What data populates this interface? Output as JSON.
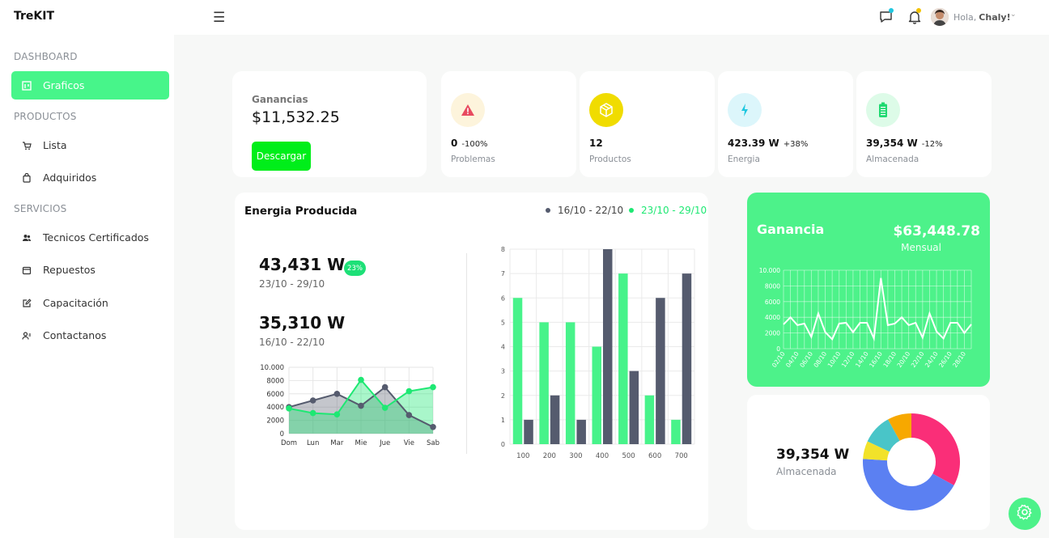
{
  "app": {
    "brand": "TreKIT"
  },
  "sidebar": {
    "sections": [
      {
        "title": "DASHBOARD",
        "items": [
          {
            "label": "Graficos",
            "icon": "chart-icon",
            "active": true
          }
        ]
      },
      {
        "title": "PRODUCTOS",
        "items": [
          {
            "label": "Lista",
            "icon": "cart-icon"
          },
          {
            "label": "Adquiridos",
            "icon": "bag-icon"
          }
        ]
      },
      {
        "title": "SERVICIOS",
        "items": [
          {
            "label": "Tecnicos Certificados",
            "icon": "users-icon"
          },
          {
            "label": "Repuestos",
            "icon": "box-icon"
          },
          {
            "label": "Capacitación",
            "icon": "edit-icon"
          },
          {
            "label": "Contactanos",
            "icon": "user-contact-icon"
          }
        ]
      }
    ]
  },
  "topbar": {
    "greeting": "Hola,",
    "username": "Chaly!"
  },
  "ganancias": {
    "title": "Ganancias",
    "value": "$11,532.25",
    "button": "Descargar"
  },
  "stats": [
    {
      "value": "0",
      "change": "-100%",
      "label": "Problemas",
      "icon": "warning-icon",
      "color": "#fdf4dc",
      "icon_color": "#e84a5f"
    },
    {
      "value": "12",
      "change": "",
      "label": "Productos",
      "icon": "package-icon",
      "color": "#f0dc00",
      "icon_color": "#ffffff"
    },
    {
      "value": "423.39 W",
      "change": "+38%",
      "label": "Energia",
      "icon": "bolt-icon",
      "color": "#dcf6fb",
      "icon_color": "#1fc7e0"
    },
    {
      "value": "39,354 W",
      "change": "-12%",
      "label": "Almacenada",
      "icon": "battery-icon",
      "color": "#ddfbe8",
      "icon_color": "#1ed970"
    }
  ],
  "energia": {
    "title": "Energia Producida",
    "legend": [
      {
        "label": "16/10 - 22/10",
        "color": "#555b6e"
      },
      {
        "label": "23/10 - 29/10",
        "color": "#1ee873"
      }
    ],
    "current": {
      "value": "43,431 W",
      "range": "23/10 - 29/10",
      "badge": "23%"
    },
    "previous": {
      "value": "35,310 W",
      "range": "16/10 - 22/10"
    }
  },
  "ganancia_card": {
    "title": "Ganancia",
    "value": "$63,448.78",
    "sub": "Mensual"
  },
  "almacenada": {
    "value": "39,354 W",
    "label": "Almacenada"
  },
  "chart_data": [
    {
      "type": "area",
      "categories": [
        "Dom",
        "Lun",
        "Mar",
        "Mie",
        "Jue",
        "Vie",
        "Sab"
      ],
      "ylim": [
        0,
        10000
      ],
      "yticks": [
        "10.000",
        "8000",
        "6000",
        "4000",
        "2000",
        "0"
      ],
      "series": [
        {
          "name": "16/10 - 22/10",
          "values": [
            4000,
            5000,
            6000,
            4200,
            7000,
            2800,
            1000
          ],
          "color": "#555b6e"
        },
        {
          "name": "23/10 - 29/10",
          "values": [
            3800,
            3100,
            2900,
            8100,
            3900,
            6400,
            7000
          ],
          "color": "#1ee873"
        }
      ]
    },
    {
      "type": "bar",
      "categories": [
        "100",
        "200",
        "300",
        "400",
        "500",
        "600",
        "700"
      ],
      "ylim": [
        0,
        8
      ],
      "yticks": [
        "8",
        "7",
        "6",
        "5",
        "4",
        "3",
        "2",
        "1",
        "0"
      ],
      "series": [
        {
          "name": "23/10 - 29/10",
          "values": [
            6,
            5,
            5,
            4,
            7,
            2,
            1
          ],
          "color": "#47f38a"
        },
        {
          "name": "16/10 - 22/10",
          "values": [
            1,
            2,
            1,
            8,
            3,
            6,
            7
          ],
          "color": "#555b6e"
        }
      ]
    },
    {
      "type": "line",
      "x": [
        "02/10",
        "03/10",
        "04/10",
        "05/10",
        "06/10",
        "07/10",
        "08/10",
        "09/10",
        "10/10",
        "11/10",
        "12/10",
        "13/10",
        "14/10",
        "15/10",
        "16/10",
        "17/10",
        "18/10",
        "19/10",
        "20/10",
        "21/10",
        "22/10",
        "23/10",
        "24/10",
        "25/10",
        "26/10",
        "27/10",
        "28/10",
        "29/10"
      ],
      "xticks": [
        "02/10",
        "04/10",
        "06/10",
        "08/10",
        "10/10",
        "12/10",
        "14/10",
        "16/10",
        "18/10",
        "20/10",
        "22/10",
        "24/10",
        "26/10",
        "28/10"
      ],
      "ylim": [
        0,
        10000
      ],
      "yticks": [
        "10.000",
        "8000",
        "6000",
        "4000",
        "2000",
        "0"
      ],
      "series": [
        {
          "values": [
            3100,
            4000,
            3000,
            3200,
            1500,
            4500,
            2100,
            1200,
            3200,
            3300,
            2100,
            3300,
            3300,
            1300,
            9000,
            3000,
            3200,
            4000,
            3000,
            3300,
            1400,
            4500,
            2200,
            1300,
            3300,
            3300,
            2000,
            3100
          ],
          "color": "#ffffff"
        }
      ]
    },
    {
      "type": "pie",
      "donut": true,
      "slices": [
        {
          "value": 33,
          "color": "#fa2e78"
        },
        {
          "value": 43,
          "color": "#5b80f2"
        },
        {
          "value": 6,
          "color": "#f2e22a"
        },
        {
          "value": 10,
          "color": "#49c5c8"
        },
        {
          "value": 8,
          "color": "#f7a800"
        }
      ]
    }
  ]
}
